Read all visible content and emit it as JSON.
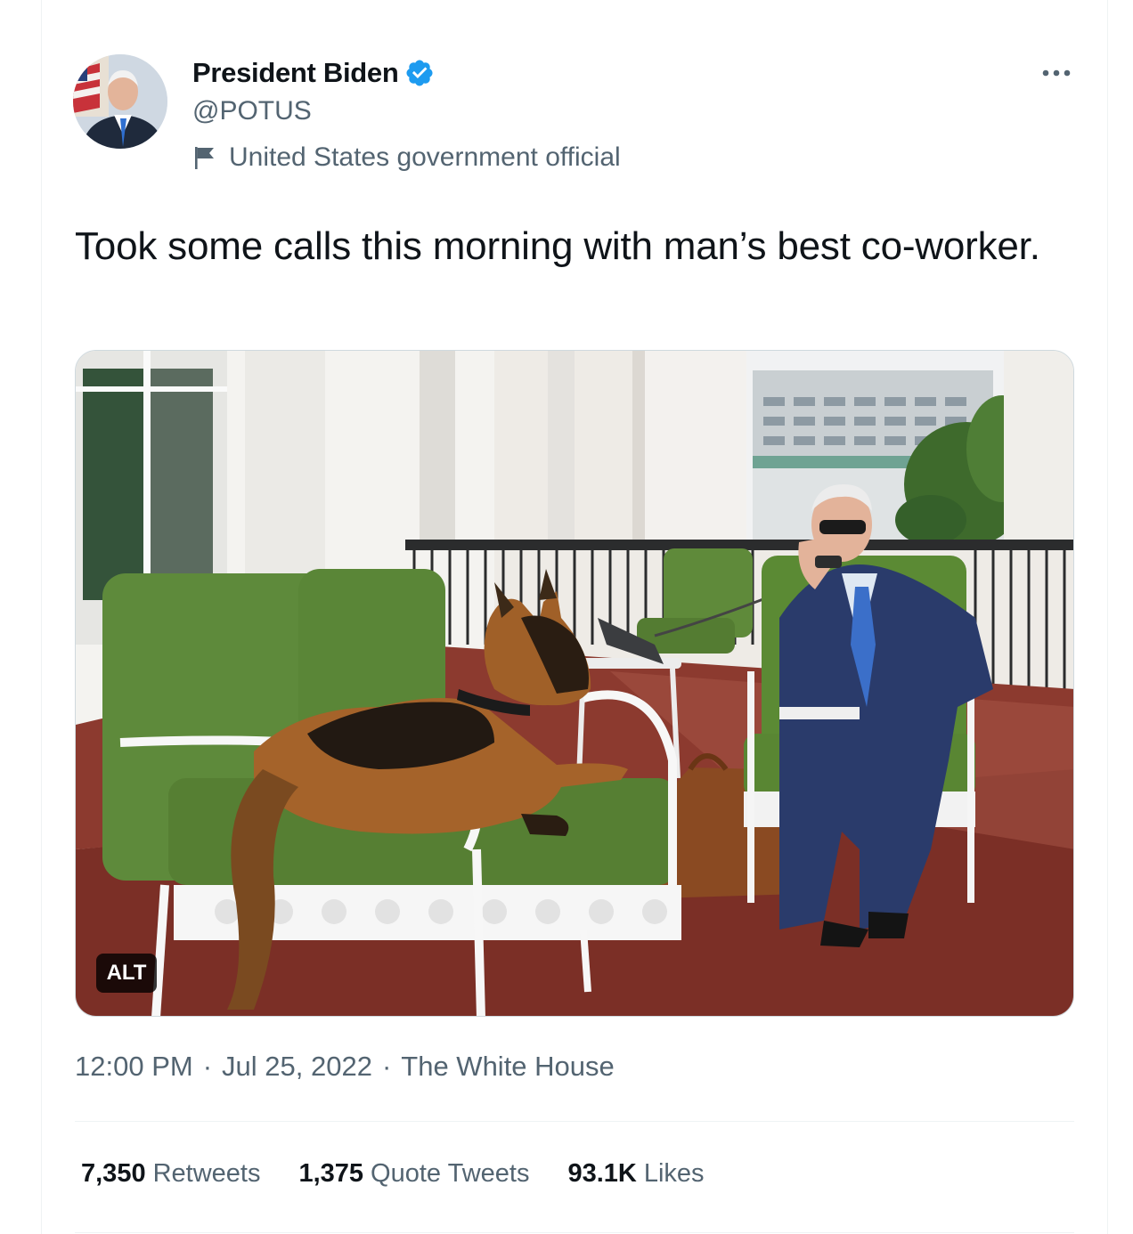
{
  "author": {
    "display_name": "President Biden",
    "handle": "@POTUS",
    "label": "United States government official",
    "verified_icon": "verified-badge-icon",
    "label_icon": "flag-icon"
  },
  "menu": {
    "more_icon": "more-icon"
  },
  "tweet": {
    "text": "Took some calls this morning with man’s best co-worker.",
    "alt_badge": "ALT"
  },
  "meta": {
    "time": "12:00 PM",
    "separator": "·",
    "date": "Jul 25, 2022",
    "source": "The White House"
  },
  "stats": {
    "retweets_count": "7,350",
    "retweets_label": "Retweets",
    "quotes_count": "1,375",
    "quotes_label": "Quote Tweets",
    "likes_count": "93.1K",
    "likes_label": "Likes"
  },
  "colors": {
    "text": "#0f1419",
    "secondary": "#536471",
    "verified": "#1d9bf0",
    "border": "#eff3f4"
  }
}
